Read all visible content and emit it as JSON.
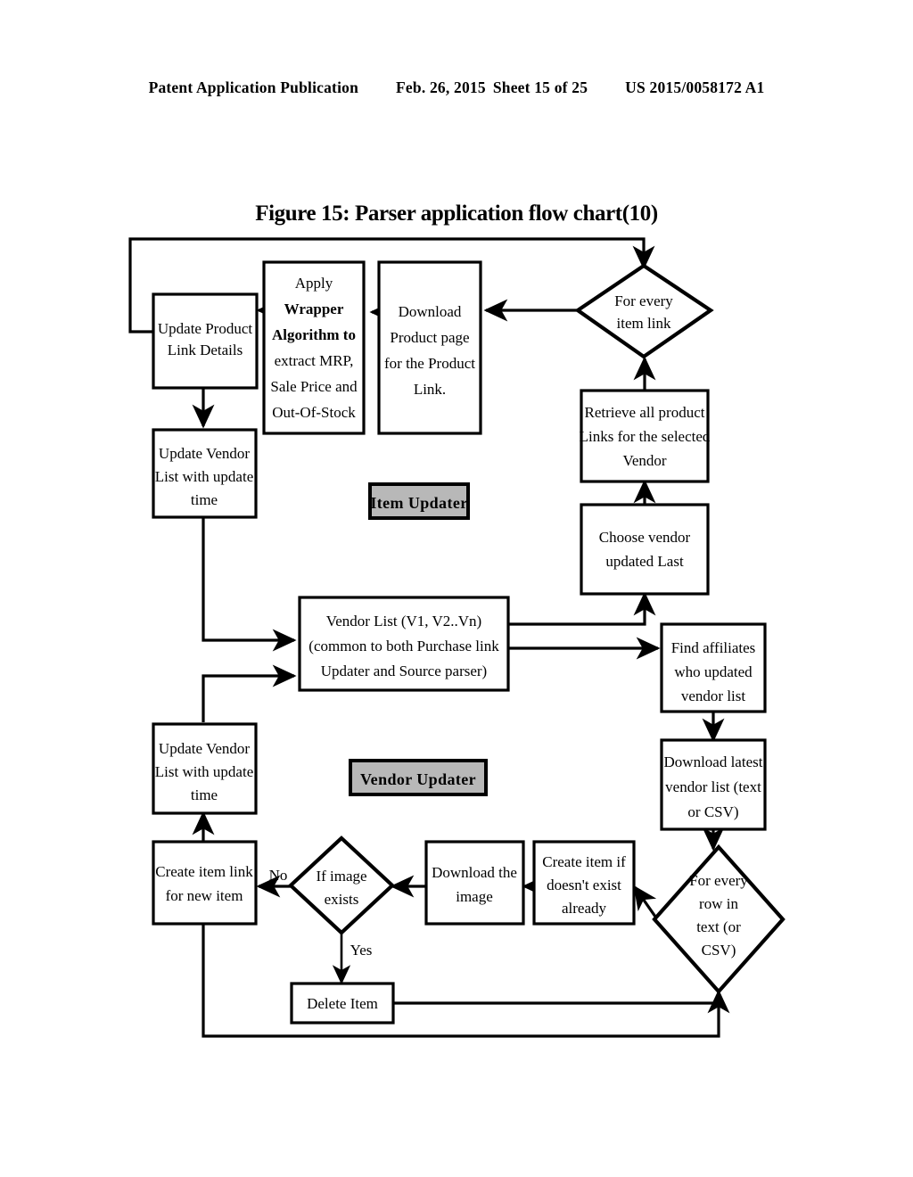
{
  "header": {
    "publication": "Patent Application Publication",
    "date": "Feb. 26, 2015",
    "sheet": "Sheet 15 of 25",
    "docnum": "US 2015/0058172 A1"
  },
  "figure": {
    "title": "Figure 15: Parser application flow chart(10)"
  },
  "chart_data": {
    "type": "diagram",
    "title": "Figure 15: Parser application flow chart(10)",
    "groups": [
      {
        "id": "item-updater",
        "label": "Item Updater"
      },
      {
        "id": "vendor-updater",
        "label": "Vendor Updater"
      }
    ],
    "nodes": [
      {
        "id": "update-product-link-details",
        "shape": "process",
        "lines": [
          "Update Product",
          "Link Details"
        ]
      },
      {
        "id": "apply-wrapper-algorithm",
        "shape": "process",
        "lines": [
          "Apply",
          "Wrapper",
          "Algorithm to",
          "extract MRP,",
          "Sale Price and",
          "Out-Of-Stock"
        ],
        "bold_lines": [
          1,
          2
        ]
      },
      {
        "id": "download-product-page",
        "shape": "process",
        "lines": [
          "Download",
          "Product page",
          "for the Product",
          "Link."
        ]
      },
      {
        "id": "for-every-item-link",
        "shape": "decision",
        "lines": [
          "For every",
          "item link"
        ]
      },
      {
        "id": "retrieve-all-product-links",
        "shape": "process",
        "lines": [
          "Retrieve all product",
          "Links for the selected",
          "Vendor"
        ]
      },
      {
        "id": "choose-vendor-updated-last",
        "shape": "process",
        "lines": [
          "Choose vendor",
          "updated Last"
        ]
      },
      {
        "id": "update-vendor-list-top",
        "shape": "process",
        "lines": [
          "Update Vendor",
          "List with update",
          "time"
        ]
      },
      {
        "id": "vendor-list",
        "shape": "process",
        "lines": [
          "Vendor List (V1, V2..Vn)",
          "(common to both Purchase link",
          "Updater and Source parser)"
        ]
      },
      {
        "id": "find-affiliates",
        "shape": "process",
        "lines": [
          "Find affiliates",
          "who updated",
          "vendor list"
        ]
      },
      {
        "id": "download-latest-vendor-list",
        "shape": "process",
        "lines": [
          "Download latest",
          "vendor list (text",
          "or CSV)"
        ]
      },
      {
        "id": "update-vendor-list-bottom",
        "shape": "process",
        "lines": [
          "Update Vendor",
          "List with update",
          "time"
        ]
      },
      {
        "id": "create-item-link",
        "shape": "process",
        "lines": [
          "Create item link",
          "for new item"
        ]
      },
      {
        "id": "if-image-exists",
        "shape": "decision",
        "lines": [
          "If image",
          "exists"
        ]
      },
      {
        "id": "download-the-image",
        "shape": "process",
        "lines": [
          "Download the",
          "image"
        ]
      },
      {
        "id": "create-item-if-not-exist",
        "shape": "process",
        "lines": [
          "Create item if",
          "doesn't exist",
          "already"
        ]
      },
      {
        "id": "for-every-row-in-text",
        "shape": "decision",
        "lines": [
          "For every",
          "row in",
          "text (or",
          "CSV)"
        ]
      },
      {
        "id": "delete-item",
        "shape": "process",
        "lines": [
          "Delete Item"
        ]
      }
    ],
    "edge_labels": [
      {
        "id": "edge-label-no",
        "text": "No"
      },
      {
        "id": "edge-label-yes",
        "text": "Yes"
      }
    ],
    "edges": [
      {
        "from": "for-every-item-link",
        "to": "download-product-page"
      },
      {
        "from": "download-product-page",
        "to": "apply-wrapper-algorithm"
      },
      {
        "from": "apply-wrapper-algorithm",
        "to": "update-product-link-details"
      },
      {
        "from": "update-product-link-details",
        "to": "for-every-item-link"
      },
      {
        "from": "update-product-link-details",
        "to": "update-vendor-list-top"
      },
      {
        "from": "update-vendor-list-top",
        "to": "vendor-list"
      },
      {
        "from": "vendor-list",
        "to": "choose-vendor-updated-last"
      },
      {
        "from": "choose-vendor-updated-last",
        "to": "retrieve-all-product-links"
      },
      {
        "from": "retrieve-all-product-links",
        "to": "for-every-item-link"
      },
      {
        "from": "vendor-list",
        "to": "find-affiliates"
      },
      {
        "from": "find-affiliates",
        "to": "download-latest-vendor-list"
      },
      {
        "from": "download-latest-vendor-list",
        "to": "for-every-row-in-text"
      },
      {
        "from": "for-every-row-in-text",
        "to": "create-item-if-not-exist"
      },
      {
        "from": "create-item-if-not-exist",
        "to": "download-the-image"
      },
      {
        "from": "download-the-image",
        "to": "if-image-exists"
      },
      {
        "from": "if-image-exists",
        "to": "create-item-link",
        "label": "No"
      },
      {
        "from": "if-image-exists",
        "to": "delete-item",
        "label": "Yes"
      },
      {
        "from": "delete-item",
        "to": "for-every-row-in-text"
      },
      {
        "from": "create-item-link",
        "to": "for-every-row-in-text"
      },
      {
        "from": "create-item-link",
        "to": "update-vendor-list-bottom"
      },
      {
        "from": "update-vendor-list-bottom",
        "to": "vendor-list"
      }
    ]
  }
}
